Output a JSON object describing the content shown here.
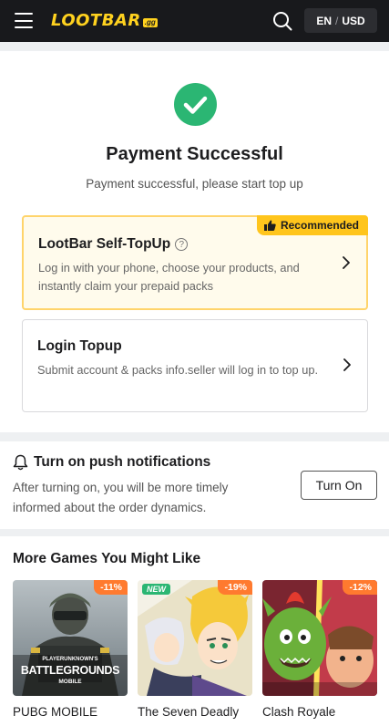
{
  "header": {
    "logo_text": "LOOTBAR",
    "logo_badge": ".gg",
    "lang": "EN",
    "currency": "USD",
    "lang_separator": "/"
  },
  "payment": {
    "title": "Payment Successful",
    "subtitle": "Payment successful, please start top up",
    "options": [
      {
        "title": "LootBar Self-TopUp",
        "badge": "Recommended",
        "description": "Log in with your phone, choose your products, and instantly claim your prepaid packs"
      },
      {
        "title": "Login Topup",
        "description": "Submit account & packs info.seller will log in to top up."
      }
    ]
  },
  "push": {
    "title": "Turn on push notifications",
    "description": "After turning on, you will be more timely informed about the order dynamics.",
    "button": "Turn On"
  },
  "games": {
    "title": "More Games You Might Like",
    "items": [
      {
        "name": "PUBG MOBILE",
        "discount": "-11%",
        "art_text_top": "PLAYERUNKNOWN'S",
        "art_text_main": "BATTLEGROUNDS",
        "art_text_sub": "MOBILE"
      },
      {
        "name": "The Seven Deadly",
        "discount": "-19%",
        "badge": "NEW"
      },
      {
        "name": "Clash Royale",
        "discount": "-12%"
      }
    ]
  },
  "colors": {
    "header_bg": "#18191c",
    "brand_yellow": "#ffd21f",
    "success_green": "#2bb673",
    "recommended_badge": "#ffc51c",
    "discount_orange": "#ff7a2f"
  }
}
